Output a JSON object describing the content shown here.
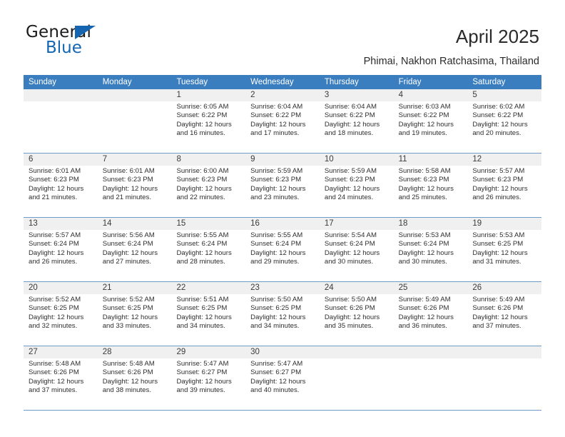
{
  "brand": {
    "name_top": "General",
    "name_bottom": "Blue",
    "color_primary": "#1267b2",
    "color_text": "#1b1b1b"
  },
  "header": {
    "title": "April 2025",
    "subtitle": "Phimai, Nakhon Ratchasima, Thailand"
  },
  "calendar": {
    "header_bg": "#3a7ebf",
    "daynum_bg": "#f0f0f0",
    "row_divider": "#6b9dc8",
    "weekdays": [
      "Sunday",
      "Monday",
      "Tuesday",
      "Wednesday",
      "Thursday",
      "Friday",
      "Saturday"
    ],
    "weeks": [
      [
        {
          "day": "",
          "detail": ""
        },
        {
          "day": "",
          "detail": ""
        },
        {
          "day": "1",
          "detail": "Sunrise: 6:05 AM\nSunset: 6:22 PM\nDaylight: 12 hours\nand 16 minutes."
        },
        {
          "day": "2",
          "detail": "Sunrise: 6:04 AM\nSunset: 6:22 PM\nDaylight: 12 hours\nand 17 minutes."
        },
        {
          "day": "3",
          "detail": "Sunrise: 6:04 AM\nSunset: 6:22 PM\nDaylight: 12 hours\nand 18 minutes."
        },
        {
          "day": "4",
          "detail": "Sunrise: 6:03 AM\nSunset: 6:22 PM\nDaylight: 12 hours\nand 19 minutes."
        },
        {
          "day": "5",
          "detail": "Sunrise: 6:02 AM\nSunset: 6:22 PM\nDaylight: 12 hours\nand 20 minutes."
        }
      ],
      [
        {
          "day": "6",
          "detail": "Sunrise: 6:01 AM\nSunset: 6:23 PM\nDaylight: 12 hours\nand 21 minutes."
        },
        {
          "day": "7",
          "detail": "Sunrise: 6:01 AM\nSunset: 6:23 PM\nDaylight: 12 hours\nand 21 minutes."
        },
        {
          "day": "8",
          "detail": "Sunrise: 6:00 AM\nSunset: 6:23 PM\nDaylight: 12 hours\nand 22 minutes."
        },
        {
          "day": "9",
          "detail": "Sunrise: 5:59 AM\nSunset: 6:23 PM\nDaylight: 12 hours\nand 23 minutes."
        },
        {
          "day": "10",
          "detail": "Sunrise: 5:59 AM\nSunset: 6:23 PM\nDaylight: 12 hours\nand 24 minutes."
        },
        {
          "day": "11",
          "detail": "Sunrise: 5:58 AM\nSunset: 6:23 PM\nDaylight: 12 hours\nand 25 minutes."
        },
        {
          "day": "12",
          "detail": "Sunrise: 5:57 AM\nSunset: 6:23 PM\nDaylight: 12 hours\nand 26 minutes."
        }
      ],
      [
        {
          "day": "13",
          "detail": "Sunrise: 5:57 AM\nSunset: 6:24 PM\nDaylight: 12 hours\nand 26 minutes."
        },
        {
          "day": "14",
          "detail": "Sunrise: 5:56 AM\nSunset: 6:24 PM\nDaylight: 12 hours\nand 27 minutes."
        },
        {
          "day": "15",
          "detail": "Sunrise: 5:55 AM\nSunset: 6:24 PM\nDaylight: 12 hours\nand 28 minutes."
        },
        {
          "day": "16",
          "detail": "Sunrise: 5:55 AM\nSunset: 6:24 PM\nDaylight: 12 hours\nand 29 minutes."
        },
        {
          "day": "17",
          "detail": "Sunrise: 5:54 AM\nSunset: 6:24 PM\nDaylight: 12 hours\nand 30 minutes."
        },
        {
          "day": "18",
          "detail": "Sunrise: 5:53 AM\nSunset: 6:24 PM\nDaylight: 12 hours\nand 30 minutes."
        },
        {
          "day": "19",
          "detail": "Sunrise: 5:53 AM\nSunset: 6:25 PM\nDaylight: 12 hours\nand 31 minutes."
        }
      ],
      [
        {
          "day": "20",
          "detail": "Sunrise: 5:52 AM\nSunset: 6:25 PM\nDaylight: 12 hours\nand 32 minutes."
        },
        {
          "day": "21",
          "detail": "Sunrise: 5:52 AM\nSunset: 6:25 PM\nDaylight: 12 hours\nand 33 minutes."
        },
        {
          "day": "22",
          "detail": "Sunrise: 5:51 AM\nSunset: 6:25 PM\nDaylight: 12 hours\nand 34 minutes."
        },
        {
          "day": "23",
          "detail": "Sunrise: 5:50 AM\nSunset: 6:25 PM\nDaylight: 12 hours\nand 34 minutes."
        },
        {
          "day": "24",
          "detail": "Sunrise: 5:50 AM\nSunset: 6:26 PM\nDaylight: 12 hours\nand 35 minutes."
        },
        {
          "day": "25",
          "detail": "Sunrise: 5:49 AM\nSunset: 6:26 PM\nDaylight: 12 hours\nand 36 minutes."
        },
        {
          "day": "26",
          "detail": "Sunrise: 5:49 AM\nSunset: 6:26 PM\nDaylight: 12 hours\nand 37 minutes."
        }
      ],
      [
        {
          "day": "27",
          "detail": "Sunrise: 5:48 AM\nSunset: 6:26 PM\nDaylight: 12 hours\nand 37 minutes."
        },
        {
          "day": "28",
          "detail": "Sunrise: 5:48 AM\nSunset: 6:26 PM\nDaylight: 12 hours\nand 38 minutes."
        },
        {
          "day": "29",
          "detail": "Sunrise: 5:47 AM\nSunset: 6:27 PM\nDaylight: 12 hours\nand 39 minutes."
        },
        {
          "day": "30",
          "detail": "Sunrise: 5:47 AM\nSunset: 6:27 PM\nDaylight: 12 hours\nand 40 minutes."
        },
        {
          "day": "",
          "detail": ""
        },
        {
          "day": "",
          "detail": ""
        },
        {
          "day": "",
          "detail": ""
        }
      ]
    ]
  }
}
